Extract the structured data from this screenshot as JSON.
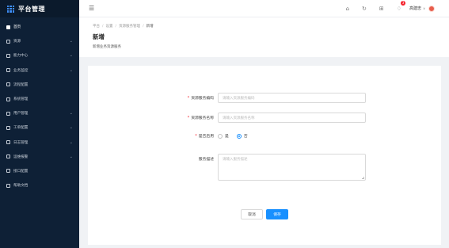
{
  "brand": {
    "title": "平台管理"
  },
  "sidebar": {
    "items": [
      {
        "label": "首页",
        "has_arrow": false,
        "active": true
      },
      {
        "label": "资源",
        "has_arrow": true,
        "active": false
      },
      {
        "label": "能力中心",
        "has_arrow": true,
        "active": false
      },
      {
        "label": "业务监控",
        "has_arrow": true,
        "active": false
      },
      {
        "label": "流程配置",
        "has_arrow": false,
        "active": false
      },
      {
        "label": "系统管理",
        "has_arrow": false,
        "active": false
      },
      {
        "label": "用户管理",
        "has_arrow": true,
        "active": false
      },
      {
        "label": "工单配置",
        "has_arrow": true,
        "active": false
      },
      {
        "label": "日志管理",
        "has_arrow": true,
        "active": false
      },
      {
        "label": "运维报警",
        "has_arrow": true,
        "active": false
      },
      {
        "label": "接口配置",
        "has_arrow": false,
        "active": false
      },
      {
        "label": "帮助文档",
        "has_arrow": false,
        "active": false
      }
    ]
  },
  "header": {
    "hamburger_icon": "☰",
    "icons": [
      "⌂",
      "↻",
      "⊞",
      "♢"
    ],
    "badge_count": "3",
    "username": "高建忠",
    "caret": "∨"
  },
  "breadcrumb": {
    "items": [
      "平台",
      "设置",
      "资源服务管理",
      "新增"
    ],
    "separator": "/"
  },
  "page": {
    "title": "新增",
    "description": "新增业务资源服务"
  },
  "form": {
    "service_code": {
      "label": "资源服务编码",
      "required": true,
      "placeholder": "请输入资源服务编码"
    },
    "service_name": {
      "label": "资源服务名称",
      "required": true,
      "placeholder": "请输入资源服务名称"
    },
    "is_enabled": {
      "label": "是否启用",
      "required": true,
      "options": [
        "是",
        "否"
      ],
      "selected": "否"
    },
    "description": {
      "label": "服务描述",
      "required": false,
      "placeholder": "请输入服务描述"
    }
  },
  "buttons": {
    "cancel": "取消",
    "save": "保存"
  }
}
